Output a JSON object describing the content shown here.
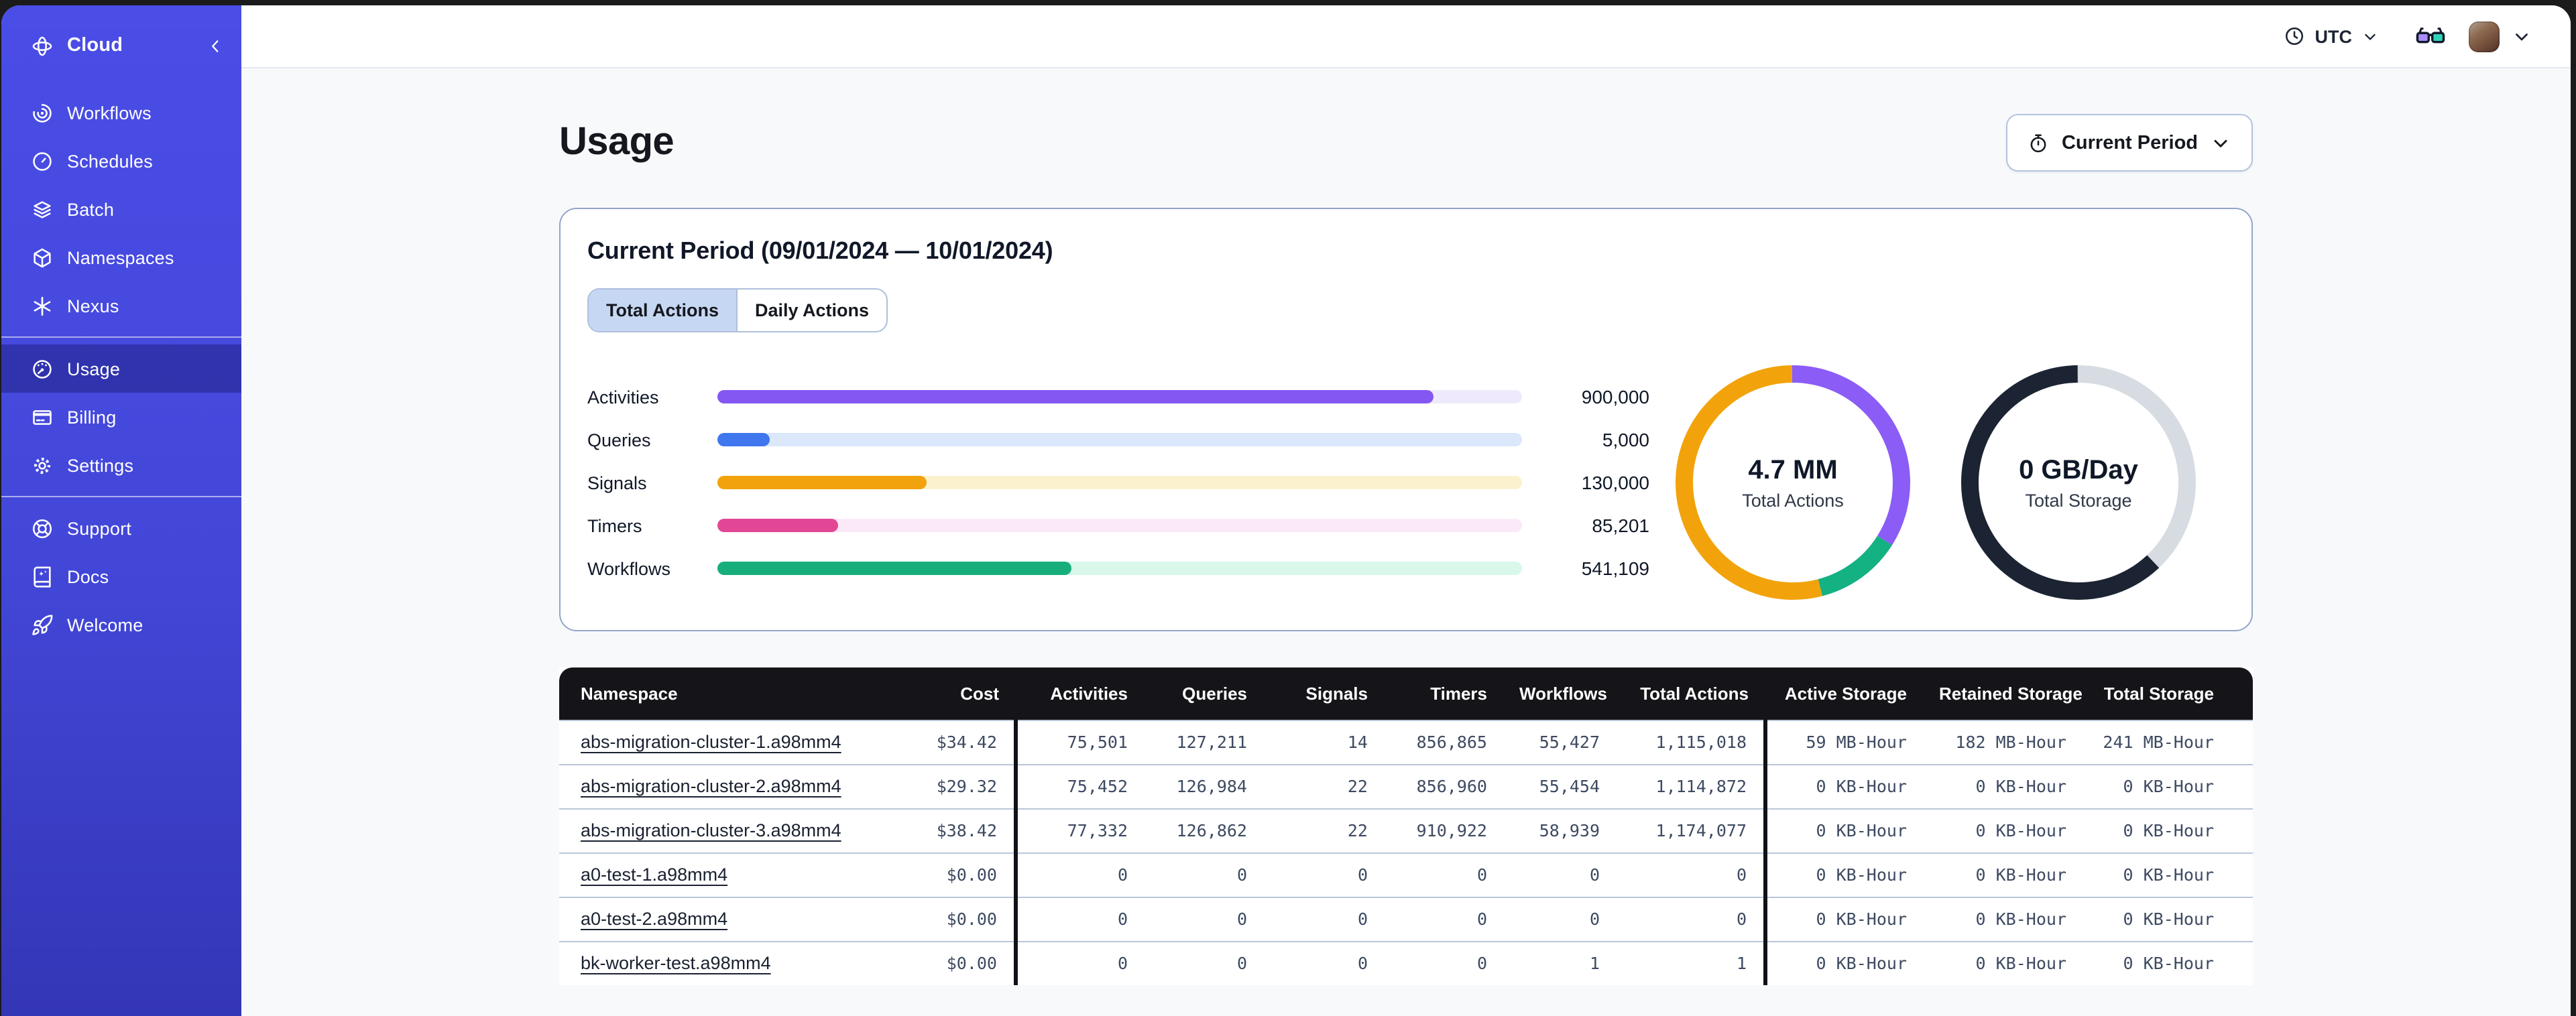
{
  "topbar": {
    "timezone": "UTC",
    "timezone_icon": "clock-icon",
    "glasses_icon": "glasses-icon",
    "account_chevron_icon": "chevron-down-icon"
  },
  "sidebar": {
    "header": {
      "label": "Cloud",
      "icon": "temporal-logo",
      "collapse_icon": "chevron-left-icon"
    },
    "sections": [
      {
        "items": [
          {
            "label": "Workflows",
            "icon": "workflows-icon"
          },
          {
            "label": "Schedules",
            "icon": "schedules-icon"
          },
          {
            "label": "Batch",
            "icon": "batch-icon"
          },
          {
            "label": "Namespaces",
            "icon": "namespaces-icon"
          },
          {
            "label": "Nexus",
            "icon": "nexus-icon"
          }
        ]
      },
      {
        "items": [
          {
            "label": "Usage",
            "icon": "usage-icon",
            "active": true
          },
          {
            "label": "Billing",
            "icon": "billing-icon"
          },
          {
            "label": "Settings",
            "icon": "settings-icon"
          }
        ]
      },
      {
        "items": [
          {
            "label": "Support",
            "icon": "support-icon"
          },
          {
            "label": "Docs",
            "icon": "docs-icon"
          },
          {
            "label": "Welcome",
            "icon": "welcome-icon"
          }
        ]
      }
    ]
  },
  "page": {
    "title": "Usage",
    "period_button": {
      "label": "Current Period",
      "icon": "stopwatch-icon",
      "chevron": "chevron-down-icon"
    }
  },
  "card": {
    "title": "Current Period (09/01/2024 — 10/01/2024)",
    "tabs": [
      {
        "label": "Total Actions",
        "active": true
      },
      {
        "label": "Daily Actions",
        "active": false
      }
    ]
  },
  "chart_data": [
    {
      "type": "bar",
      "orientation": "horizontal",
      "categories": [
        "Activities",
        "Queries",
        "Signals",
        "Timers",
        "Workflows"
      ],
      "values": [
        900000,
        5000,
        130000,
        85201,
        541109
      ],
      "display_values": [
        "900,000",
        "5,000",
        "130,000",
        "85,201",
        "541,109"
      ],
      "rows": [
        {
          "label": "Activities",
          "display": "900,000",
          "fill": "89%",
          "color": "#8457F2",
          "track": "#EFE9FD"
        },
        {
          "label": "Queries",
          "display": "5,000",
          "fill": "6.5%",
          "color": "#4077EE",
          "track": "#DBE7FB"
        },
        {
          "label": "Signals",
          "display": "130,000",
          "fill": "26%",
          "color": "#F2A20C",
          "track": "#FCF1CF"
        },
        {
          "label": "Timers",
          "display": "85,201",
          "fill": "15%",
          "color": "#E24795",
          "track": "#FCE9F7"
        },
        {
          "label": "Workflows",
          "display": "541,109",
          "fill": "44%",
          "color": "#17AE7C",
          "track": "#D9F8EA"
        }
      ]
    },
    {
      "type": "donut",
      "center_value": "4.7 MM",
      "center_label": "Total Actions",
      "segments": [
        {
          "name": "purple",
          "pct": 34,
          "color": "#8B5CF6"
        },
        {
          "name": "green",
          "pct": 12,
          "color": "#14B182"
        },
        {
          "name": "orange",
          "pct": 54,
          "color": "#F2A30B"
        }
      ]
    },
    {
      "type": "donut",
      "center_value": "0 GB/Day",
      "center_label": "Total Storage",
      "segments": [
        {
          "name": "light",
          "pct": 38,
          "color": "#D7DBE2"
        },
        {
          "name": "dark",
          "pct": 62,
          "color": "#1C2433"
        }
      ]
    }
  ],
  "table": {
    "columns": [
      "Namespace",
      "Cost",
      "Activities",
      "Queries",
      "Signals",
      "Timers",
      "Workflows",
      "Total Actions",
      "Active Storage",
      "Retained Storage",
      "Total Storage"
    ],
    "rows": [
      [
        "abs-migration-cluster-1.a98mm4",
        "$34.42",
        "75,501",
        "127,211",
        "14",
        "856,865",
        "55,427",
        "1,115,018",
        "59 MB-Hour",
        "182 MB-Hour",
        "241 MB-Hour"
      ],
      [
        "abs-migration-cluster-2.a98mm4",
        "$29.32",
        "75,452",
        "126,984",
        "22",
        "856,960",
        "55,454",
        "1,114,872",
        "0 KB-Hour",
        "0 KB-Hour",
        "0 KB-Hour"
      ],
      [
        "abs-migration-cluster-3.a98mm4",
        "$38.42",
        "77,332",
        "126,862",
        "22",
        "910,922",
        "58,939",
        "1,174,077",
        "0 KB-Hour",
        "0 KB-Hour",
        "0 KB-Hour"
      ],
      [
        "a0-test-1.a98mm4",
        "$0.00",
        "0",
        "0",
        "0",
        "0",
        "0",
        "0",
        "0 KB-Hour",
        "0 KB-Hour",
        "0 KB-Hour"
      ],
      [
        "a0-test-2.a98mm4",
        "$0.00",
        "0",
        "0",
        "0",
        "0",
        "0",
        "0",
        "0 KB-Hour",
        "0 KB-Hour",
        "0 KB-Hour"
      ],
      [
        "bk-worker-test.a98mm4",
        "$0.00",
        "0",
        "0",
        "0",
        "0",
        "1",
        "1",
        "0 KB-Hour",
        "0 KB-Hour",
        "0 KB-Hour"
      ]
    ]
  }
}
